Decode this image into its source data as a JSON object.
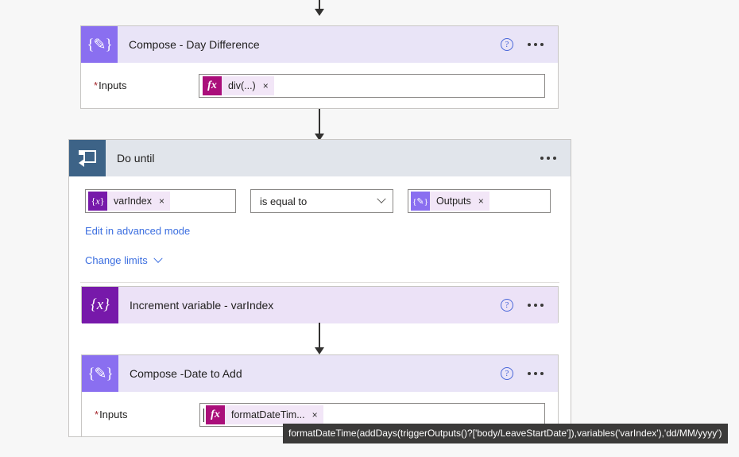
{
  "page": {
    "background": "#f7f7f7",
    "app": "power-automate-flow-designer"
  },
  "colors": {
    "compose_icon_bg": "#8a6ff0",
    "variable_icon_bg": "#7719aa",
    "loop_icon_bg": "#3d6387",
    "compose_header_bg": "#e9e4f7",
    "variable_header_bg": "#ece2f7",
    "scope_header_bg": "#e1e5eb",
    "fx_icon_bg": "#aa0e7a",
    "chip_bg": "#f2e6f7",
    "link_blue": "#3b6ee0",
    "required_red": "#a4262c",
    "tooltip_bg": "#3b3a39"
  },
  "compose_day_difference": {
    "icon": "compose-braces-pencil-icon",
    "title": "Compose - Day Difference",
    "help_icon": "help-circle-icon",
    "menu_icon": "ellipsis-icon",
    "inputs": {
      "label": "Inputs",
      "required_marker": "*",
      "token": {
        "icon": "fx-icon",
        "icon_text": "fx",
        "label": "div(...)",
        "remove": "×"
      }
    }
  },
  "do_until": {
    "icon": "loop-icon",
    "title": "Do until",
    "menu_icon": "ellipsis-icon",
    "condition": {
      "left": {
        "icon": "variable-braces-x-icon",
        "icon_text": "{x}",
        "label": "varIndex",
        "remove": "×"
      },
      "operator": {
        "value": "is equal to",
        "chevron": "chevron-down-icon"
      },
      "right": {
        "icon": "compose-braces-pencil-icon",
        "icon_text": "{✐}",
        "label": "Outputs",
        "remove": "×"
      }
    },
    "advanced_link": "Edit in advanced mode",
    "change_limits_link": "Change limits",
    "change_limits_chevron": "chevron-down-icon"
  },
  "increment_variable": {
    "icon": "variable-braces-x-icon",
    "icon_text": "{x}",
    "title": "Increment variable - varIndex",
    "help_icon": "help-circle-icon",
    "menu_icon": "ellipsis-icon"
  },
  "compose_date_to_add": {
    "icon": "compose-braces-pencil-icon",
    "title": "Compose -Date to Add",
    "help_icon": "help-circle-icon",
    "menu_icon": "ellipsis-icon",
    "inputs": {
      "label": "Inputs",
      "required_marker": "*",
      "token": {
        "icon": "fx-icon",
        "icon_text": "fx",
        "label": "formatDateTim...",
        "remove": "×"
      }
    }
  },
  "tooltip": {
    "text": "formatDateTime(addDays(triggerOutputs()?['body/LeaveStartDate']),variables('varIndex'),'dd/MM/yyyy')"
  }
}
